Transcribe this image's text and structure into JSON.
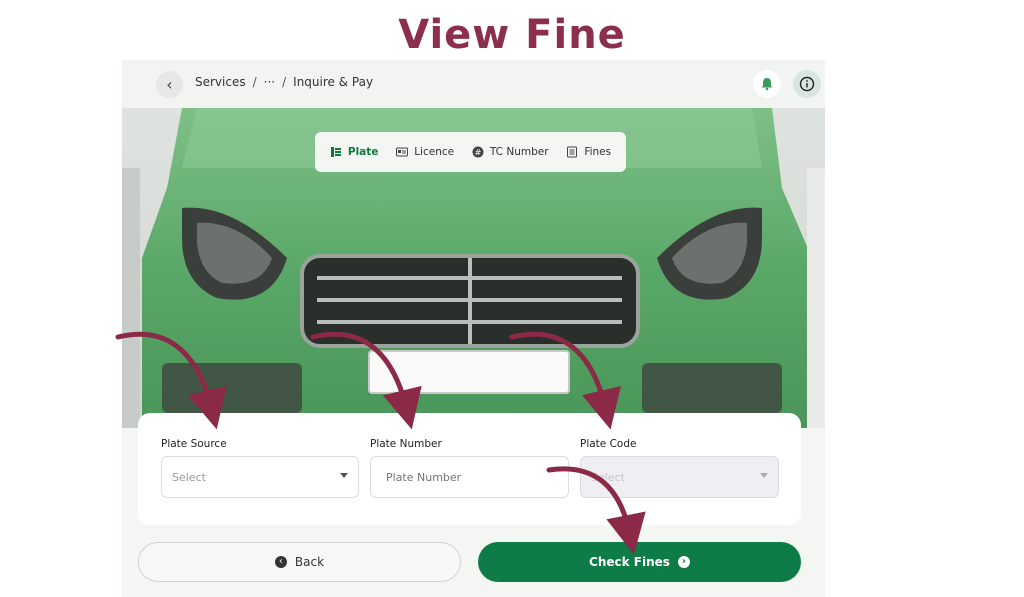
{
  "page_title": "View Fine",
  "header": {
    "breadcrumb": [
      "Services",
      "/",
      "···",
      "/",
      "Inquire & Pay"
    ]
  },
  "tabs": [
    {
      "label": "Plate",
      "icon": "car-icon",
      "active": true
    },
    {
      "label": "Licence",
      "icon": "id-card-icon",
      "active": false
    },
    {
      "label": "TC Number",
      "icon": "hash-icon",
      "active": false
    },
    {
      "label": "Fines",
      "icon": "document-icon",
      "active": false
    }
  ],
  "form": {
    "plate_source": {
      "label": "Plate Source",
      "placeholder": "Select"
    },
    "plate_number": {
      "label": "Plate Number",
      "placeholder": "Plate Number"
    },
    "plate_code": {
      "label": "Plate Code",
      "placeholder": "Select"
    }
  },
  "buttons": {
    "back": "Back",
    "check_fines": "Check Fines"
  },
  "colors": {
    "brand_green": "#0d7c46",
    "title_maroon": "#8c2f4e",
    "arrow_maroon": "#8b2a47"
  }
}
